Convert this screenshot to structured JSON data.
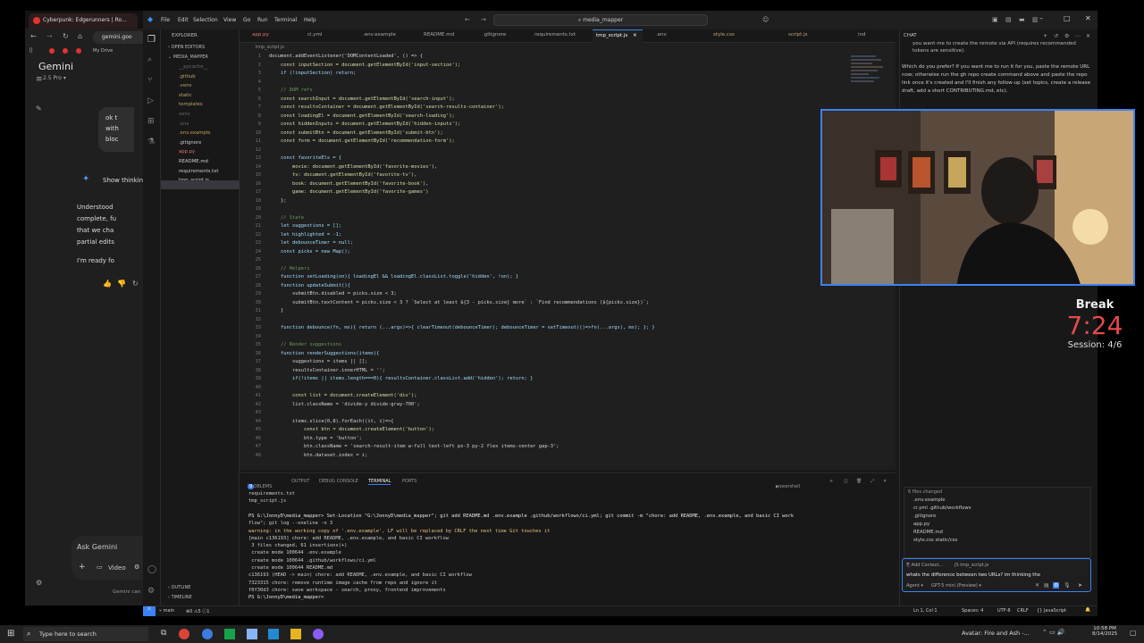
{
  "browser": {
    "tab_title": "Cyberpunk: Edgerunners | Ro...",
    "url": "gemini.goo",
    "bookmark": "My Drive",
    "app_title": "Gemini",
    "model": "2.5 Pro",
    "user_bubble": [
      "ok t",
      "with",
      "bloc"
    ],
    "show_thinking": "Show thinkin",
    "response": [
      "Understood",
      "complete, fu",
      "that we cha",
      "partial edits"
    ],
    "ready": "I'm ready fo",
    "ask_placeholder": "Ask Gemini",
    "video": "Video",
    "footer": "Gemini can"
  },
  "vscode": {
    "menu": [
      "File",
      "Edit",
      "Selection",
      "View",
      "Go",
      "Run",
      "Terminal",
      "Help"
    ],
    "search": "media_mapper",
    "explorer_title": "EXPLORER",
    "open_editors": "OPEN EDITORS",
    "project": "MEDIA_MAPPER",
    "tree": [
      {
        "name": "__pycache__",
        "color": "#6b6b6b"
      },
      {
        "name": ".github",
        "color": "#c5a56a"
      },
      {
        "name": ".venv",
        "color": "#c5a56a"
      },
      {
        "name": "static",
        "color": "#c5a56a"
      },
      {
        "name": "templates",
        "color": "#c5a56a"
      },
      {
        "name": "venv",
        "color": "#6b6b6b"
      },
      {
        "name": ".env",
        "color": "#6b6b6b"
      },
      {
        "name": ".env.example",
        "color": "#c9a253"
      },
      {
        "name": ".gitignore",
        "color": "#cccccc"
      },
      {
        "name": "app.py",
        "color": "#e0786a"
      },
      {
        "name": "README.md",
        "color": "#cccccc"
      },
      {
        "name": "requirements.txt",
        "color": "#cccccc"
      },
      {
        "name": "tmp_script.js",
        "color": "#cccccc"
      }
    ],
    "outline": "OUTLINE",
    "timeline": "TIMELINE",
    "tabs": [
      "app.py",
      "ci.yml",
      ".env.example",
      "README.md",
      ".gitignore",
      "requirements.txt",
      "tmp_script.js",
      ".env",
      "style.css",
      "script.js",
      "ind"
    ],
    "breadcrumb": "tmp_script.js",
    "code_lines": [
      "document.addEventListener('DOMContentLoaded', () => {",
      "    const inputSection = document.getElementById('input-section');",
      "    if (!inputSection) return;",
      "",
      "    // DOM refs",
      "    const searchInput = document.getElementById('search-input');",
      "    const resultsContainer = document.getElementById('search-results-container');",
      "    const loadingEl = document.getElementById('search-loading');",
      "    const hiddenInputs = document.getElementById('hidden-inputs');",
      "    const submitBtn = document.getElementById('submit-btn');",
      "    const form = document.getElementById('recommendation-form');",
      "",
      "    const favoriteEls = {",
      "        movie: document.getElementById('favorite-movies'),",
      "        tv: document.getElementById('favorite-tv'),",
      "        book: document.getElementById('favorite-book'),",
      "        game: document.getElementById('favorite-games')",
      "    };",
      "",
      "    // State",
      "    let suggestions = [];",
      "    let highlighted = -1;",
      "    let debounceTimer = null;",
      "    const picks = new Map();",
      "",
      "    // Helpers",
      "    function setLoading(on){ loadingEl && loadingEl.classList.toggle('hidden', !on); }",
      "    function updateSubmit(){",
      "        submitBtn.disabled = picks.size < 3;",
      "        submitBtn.textContent = picks.size < 3 ? `Select at least ${3 - picks.size} more` : `Find recommendations (${picks.size})`;",
      "    }",
      "",
      "    function debounce(fn, ms){ return (...args)=>{ clearTimeout(debounceTimer); debounceTimer = setTimeout(()=>fn(...args), ms); }; }",
      "",
      "    // Render suggestions",
      "    function renderSuggestions(items){",
      "        suggestions = items || [];",
      "        resultsContainer.innerHTML = '';",
      "        if(!items || items.length===0){ resultsContainer.classList.add('hidden'); return; }",
      "",
      "        const list = document.createElement('div');",
      "        list.className = 'divide-y divide-gray-700';",
      "",
      "        items.slice(0,8).forEach((it, i)=>{",
      "            const btn = document.createElement('button');",
      "            btn.type = 'button';",
      "            btn.className = 'search-result-item w-full text-left px-3 py-2 flex items-center gap-3';",
      "            btn.dataset.index = i;"
    ],
    "panel_tabs": [
      "PROBLEMS",
      "OUTPUT",
      "DEBUG CONSOLE",
      "TERMINAL",
      "PORTS"
    ],
    "problems_count": "9",
    "shell": "powershell",
    "terminal_lines": [
      "requirements.txt",
      "tmp_script.js",
      "",
      "PS G:\\JonnyD\\media_mapper> Set-Location \"G:\\JonnyD\\media_mapper\"; git add README.md .env.example .github/workflows/ci.yml; git commit -m \"chore: add README, .env.example, and basic CI work",
      "flow\"; git log --oneline -n 3",
      "warning: in the working copy of '.env.example', LF will be replaced by CRLF the next time Git touches it",
      "[main c136193] chore: add README, .env.example, and basic CI workflow",
      " 3 files changed, 61 insertions(+)",
      " create mode 100644 .env.example",
      " create mode 100644 .github/workflows/ci.yml",
      " create mode 100644 README.md",
      "c136193 (HEAD -> main) chore: add README, .env.example, and basic CI workflow",
      "7323315 chore: remove runtime image cache from repo and ignore it",
      "f0f30d3 chore: save workspace - search, proxy, frontend improvements",
      "PS G:\\JonnyD\\media_mapper> "
    ],
    "chat": {
      "header": "CHAT",
      "msg_top": "you want me to create the remote via API (requires recommended tokens are sensitive).",
      "msg_body": "Which do you prefer? If you want me to run it for you, paste the remote URL now; otherwise run the gh repo create command above and paste the repo link once it's created and I'll finish any follow-up (set topics, create a release draft, add a short CONTRIBUTING.md, etc).",
      "files_changed": "6 files changed",
      "files": [
        ".env.example",
        "ci.yml .github/workflows",
        ".gitignore",
        "app.py",
        "README.md",
        "style.css static/css"
      ],
      "add_context": "Add Context...",
      "context_file": "tmp_script.js",
      "input": "whats the difference between two URLs? im thinking the",
      "agent": "Agent",
      "model": "GPT-5 mini (Preview)"
    },
    "status": {
      "branch": "main",
      "errors": "0",
      "warnings": "5",
      "info": "1",
      "position": "Ln 1, Col 1",
      "spaces": "Spaces: 4",
      "encoding": "UTF-8",
      "eol": "CRLF",
      "language": "JavaScript"
    }
  },
  "overlay": {
    "break_label": "Break",
    "timer": "7:24",
    "session": "Session: 4/6"
  },
  "taskbar": {
    "search": "Type here to search",
    "notification": "Avatar: Fire and Ash -...",
    "time": "10:58 PM",
    "date": "8/14/2025"
  },
  "colors": {
    "accent": "#3b82f6",
    "timer_red": "#e34a4a",
    "keyword": "#569cd6",
    "string": "#ce9178",
    "comment": "#6a9955"
  }
}
